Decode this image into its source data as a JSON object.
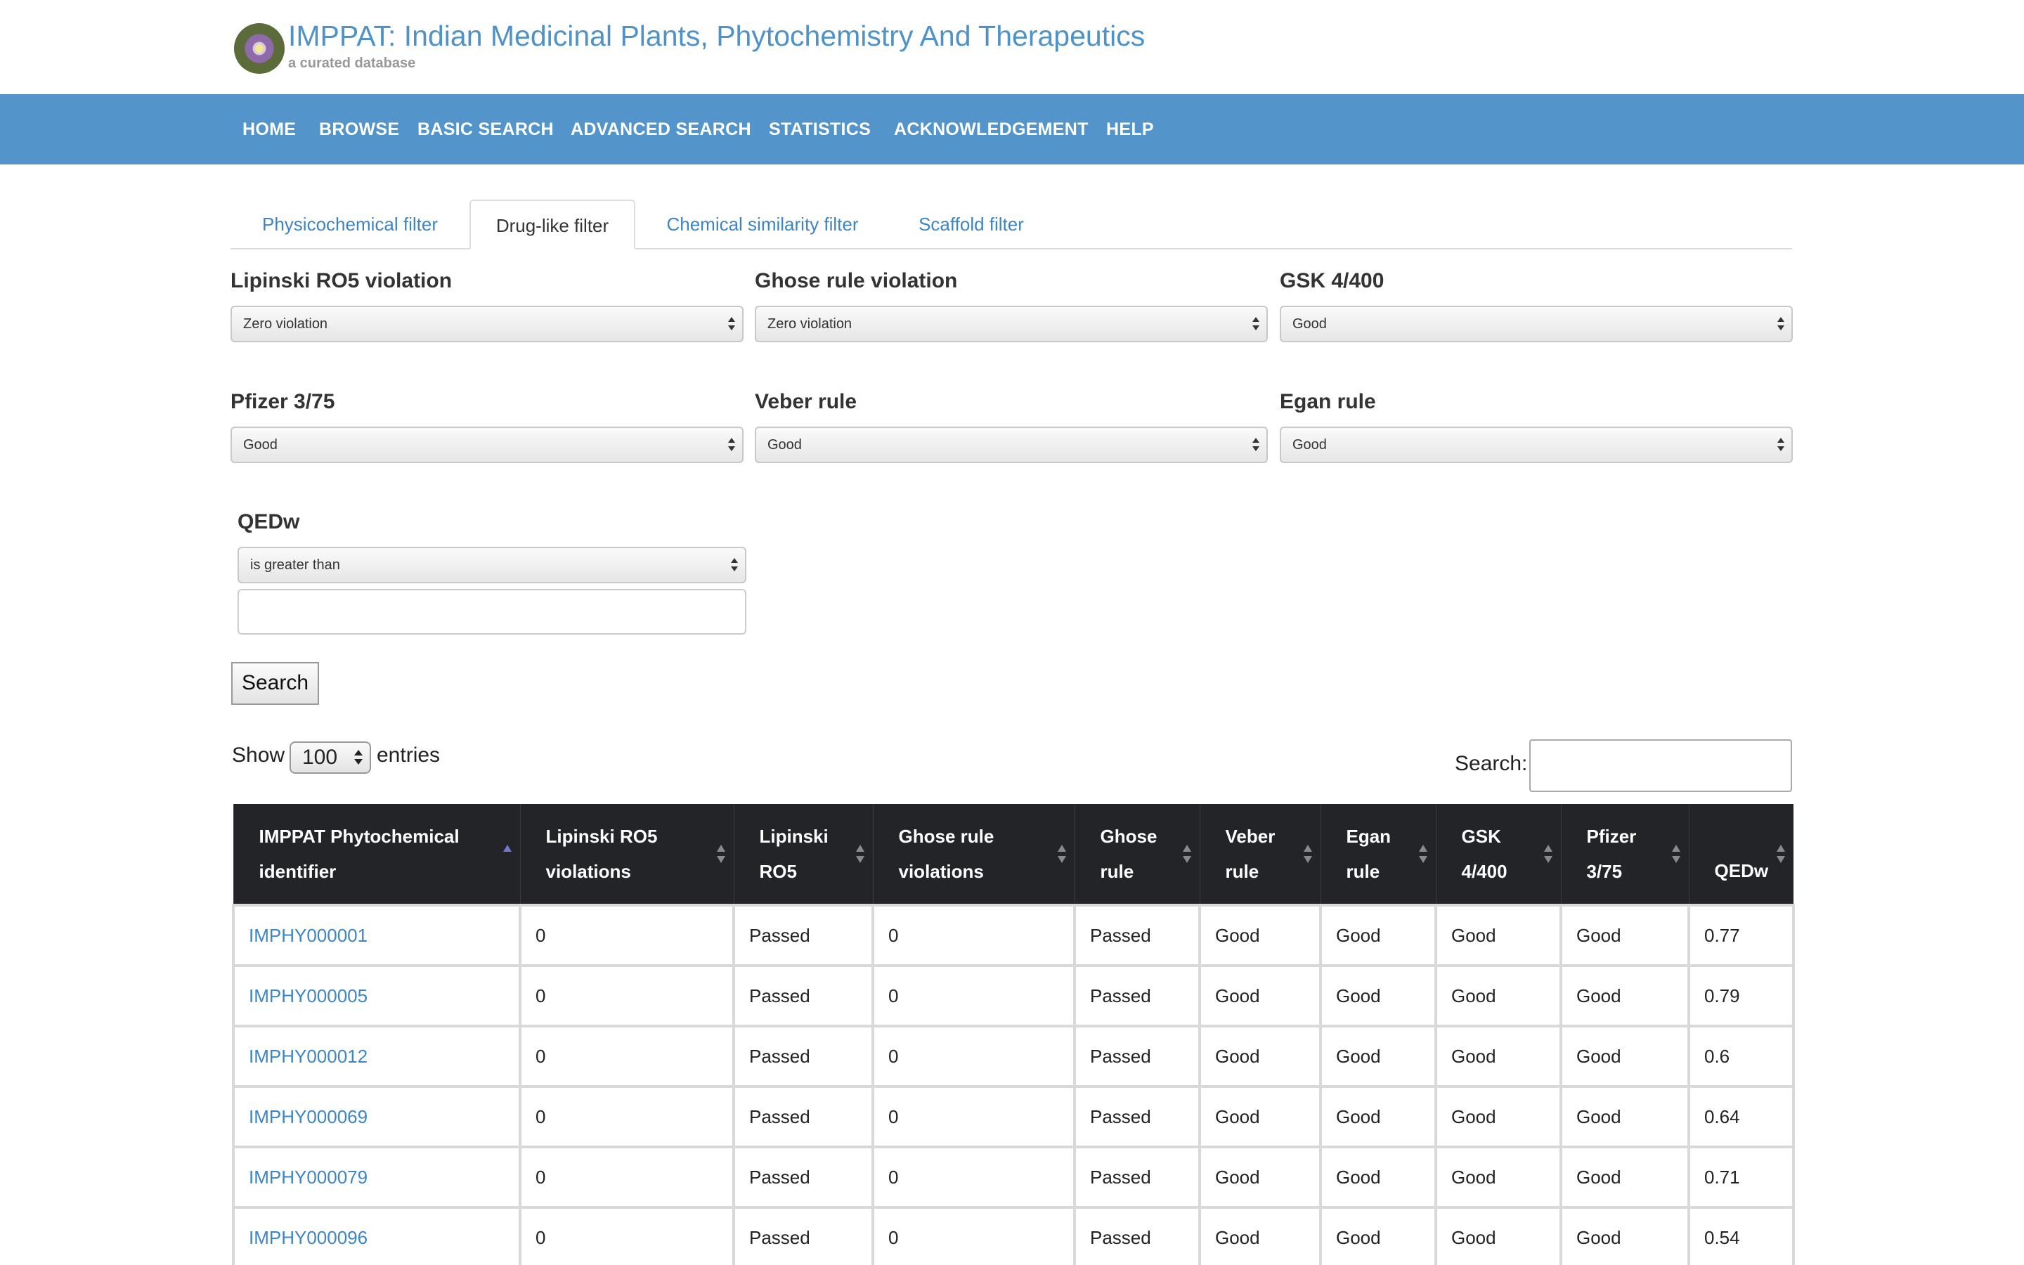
{
  "header": {
    "title": "IMPPAT: Indian Medicinal Plants, Phytochemistry And Therapeutics",
    "subtitle": "a curated database",
    "logo_icon": "flower-logo-icon"
  },
  "nav": {
    "items": [
      "HOME",
      "BROWSE",
      "BASIC SEARCH",
      "ADVANCED SEARCH",
      "STATISTICS",
      "ACKNOWLEDGEMENT",
      "HELP"
    ]
  },
  "tabs": {
    "items": [
      "Physicochemical filter",
      "Drug-like filter",
      "Chemical similarity filter",
      "Scaffold filter"
    ],
    "active": "Drug-like filter"
  },
  "filters": {
    "lipinski": {
      "label": "Lipinski RO5 violation",
      "value": "Zero violation"
    },
    "ghose": {
      "label": "Ghose rule violation",
      "value": "Zero violation"
    },
    "gsk": {
      "label": "GSK 4/400",
      "value": "Good"
    },
    "pfizer": {
      "label": "Pfizer 3/75",
      "value": "Good"
    },
    "veber": {
      "label": "Veber rule",
      "value": "Good"
    },
    "egan": {
      "label": "Egan rule",
      "value": "Good"
    },
    "qedw": {
      "label": "QEDw",
      "operator": "is greater than",
      "value": ""
    }
  },
  "search_button": "Search",
  "table_controls": {
    "show_label": "Show",
    "entries_label": "entries",
    "page_length": "100",
    "search_label": "Search:",
    "search_value": ""
  },
  "table": {
    "columns": [
      "IMPPAT Phytochemical identifier",
      "Lipinski RO5 violations",
      "Lipinski RO5",
      "Ghose rule violations",
      "Ghose rule",
      "Veber rule",
      "Egan rule",
      "GSK 4/400",
      "Pfizer 3/75",
      "QEDw"
    ],
    "rows": [
      [
        "IMPHY000001",
        "0",
        "Passed",
        "0",
        "Passed",
        "Good",
        "Good",
        "Good",
        "Good",
        "0.77"
      ],
      [
        "IMPHY000005",
        "0",
        "Passed",
        "0",
        "Passed",
        "Good",
        "Good",
        "Good",
        "Good",
        "0.79"
      ],
      [
        "IMPHY000012",
        "0",
        "Passed",
        "0",
        "Passed",
        "Good",
        "Good",
        "Good",
        "Good",
        "0.6"
      ],
      [
        "IMPHY000069",
        "0",
        "Passed",
        "0",
        "Passed",
        "Good",
        "Good",
        "Good",
        "Good",
        "0.64"
      ],
      [
        "IMPHY000079",
        "0",
        "Passed",
        "0",
        "Passed",
        "Good",
        "Good",
        "Good",
        "Good",
        "0.71"
      ],
      [
        "IMPHY000096",
        "0",
        "Passed",
        "0",
        "Passed",
        "Good",
        "Good",
        "Good",
        "Good",
        "0.54"
      ]
    ]
  },
  "colors": {
    "brand_blue": "#5394cb",
    "link_blue": "#3d85c6",
    "table_header": "#222428"
  }
}
